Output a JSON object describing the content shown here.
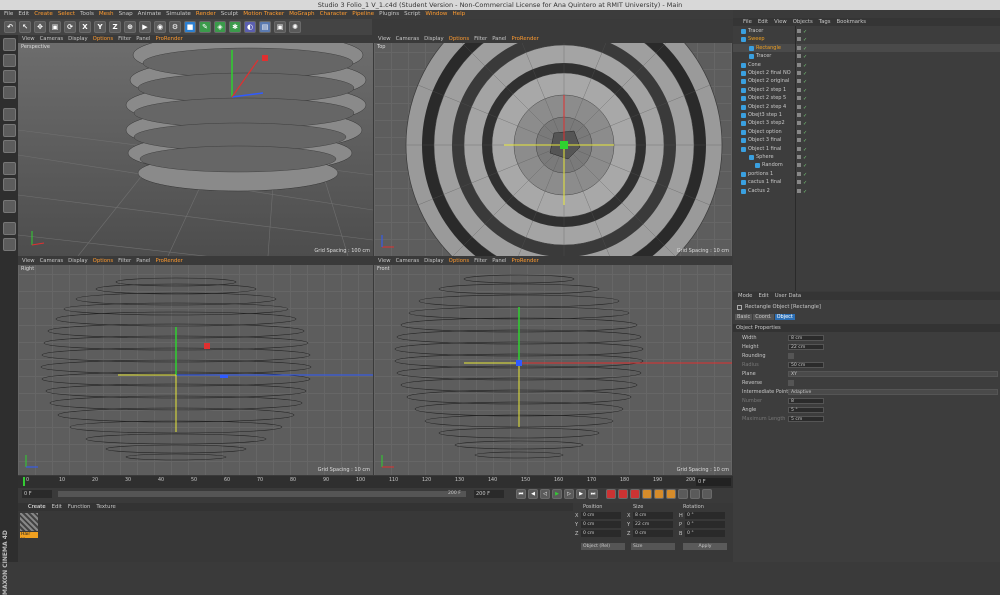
{
  "title": "Studio 3 Folio_1 V_1.c4d (Student Version - Non-Commercial License for Ana Quintero at RMIT University) - Main",
  "menus": [
    "File",
    "Edit",
    "Create",
    "Select",
    "Tools",
    "Mesh",
    "Snap",
    "Animate",
    "Simulate",
    "Render",
    "Sculpt",
    "Motion Tracker",
    "MoGraph",
    "Character",
    "Pipeline",
    "Plugins",
    "Script",
    "Window",
    "Help"
  ],
  "highlighted_menus": [
    "Create",
    "Select",
    "Mesh",
    "Render",
    "Motion Tracker",
    "MoGraph",
    "Character",
    "Pipeline",
    "Window",
    "Help"
  ],
  "toolbar_axes": [
    "X",
    "Y",
    "Z"
  ],
  "viewports": [
    {
      "name": "Perspective",
      "menu": [
        "View",
        "Cameras",
        "Display",
        "Options",
        "Filter",
        "Panel",
        "ProRender"
      ],
      "grid": "Grid Spacing : 100 cm"
    },
    {
      "name": "Top",
      "menu": [
        "View",
        "Cameras",
        "Display",
        "Options",
        "Filter",
        "Panel",
        "ProRender"
      ],
      "grid": "Grid Spacing : 10 cm"
    },
    {
      "name": "Right",
      "menu": [
        "View",
        "Cameras",
        "Display",
        "Options",
        "Filter",
        "Panel",
        "ProRender"
      ],
      "grid": "Grid Spacing : 10 cm"
    },
    {
      "name": "Front",
      "menu": [
        "View",
        "Cameras",
        "Display",
        "Options",
        "Filter",
        "Panel",
        "ProRender"
      ],
      "grid": "Grid Spacing : 10 cm"
    }
  ],
  "object_menu": [
    "File",
    "Edit",
    "View",
    "Objects",
    "Tags",
    "Bookmarks"
  ],
  "objects": [
    "Tracer",
    "Sweep",
    "Rectangle",
    "Tracer",
    "Cone",
    "Object 2 final NO",
    "Object 2 original",
    "Object 2 step 1",
    "Object 2 step 5",
    "Object 2 step 4",
    "Obejt3 step 1",
    "Object 3 step2",
    "Object option",
    "Object 3 final",
    "Object 1 final",
    "Sphere",
    "Random",
    "portions 1",
    "cactus 1 final",
    "Cactus 2"
  ],
  "attr_menu": [
    "Mode",
    "Edit",
    "User Data"
  ],
  "attr_title": "Rectangle Object [Rectangle]",
  "attr_tabs": [
    "Basic",
    "Coord.",
    "Object"
  ],
  "attr_section": "Object Properties",
  "attrs": [
    [
      "Width",
      "8 cm"
    ],
    [
      "Height",
      "22 cm"
    ],
    [
      "Rounding",
      ""
    ],
    [
      "Radius",
      "50 cm"
    ],
    [
      "Plane",
      "XY"
    ],
    [
      "Reverse",
      ""
    ],
    [
      "Intermediate Points",
      "Adaptive"
    ],
    [
      "Number",
      "8"
    ],
    [
      "Angle",
      "5 °"
    ],
    [
      "Maximum Length",
      "5 cm"
    ]
  ],
  "timeline_ticks": [
    "0",
    "10",
    "20",
    "30",
    "40",
    "50",
    "60",
    "70",
    "80",
    "90",
    "100",
    "110",
    "120",
    "130",
    "140",
    "150",
    "160",
    "170",
    "180",
    "190",
    "200"
  ],
  "play": {
    "start": "0 F",
    "current": "0 F",
    "end": "200 F",
    "end2": "200 F"
  },
  "material_menu": [
    "Create",
    "Edit",
    "Function",
    "Texture"
  ],
  "material_name": "Hair Ma",
  "coords_headers": [
    "Position",
    "Size",
    "Rotation"
  ],
  "coords": [
    [
      "X",
      "0 cm",
      "X",
      "8 cm",
      "H",
      "0 °"
    ],
    [
      "Y",
      "0 cm",
      "Y",
      "22 cm",
      "P",
      "0 °"
    ],
    [
      "Z",
      "0 cm",
      "Z",
      "0 cm",
      "B",
      "0 °"
    ]
  ],
  "coords_footer": [
    "Object (Rel)",
    "Size",
    "Apply"
  ],
  "brand": "MAXON CINEMA 4D"
}
